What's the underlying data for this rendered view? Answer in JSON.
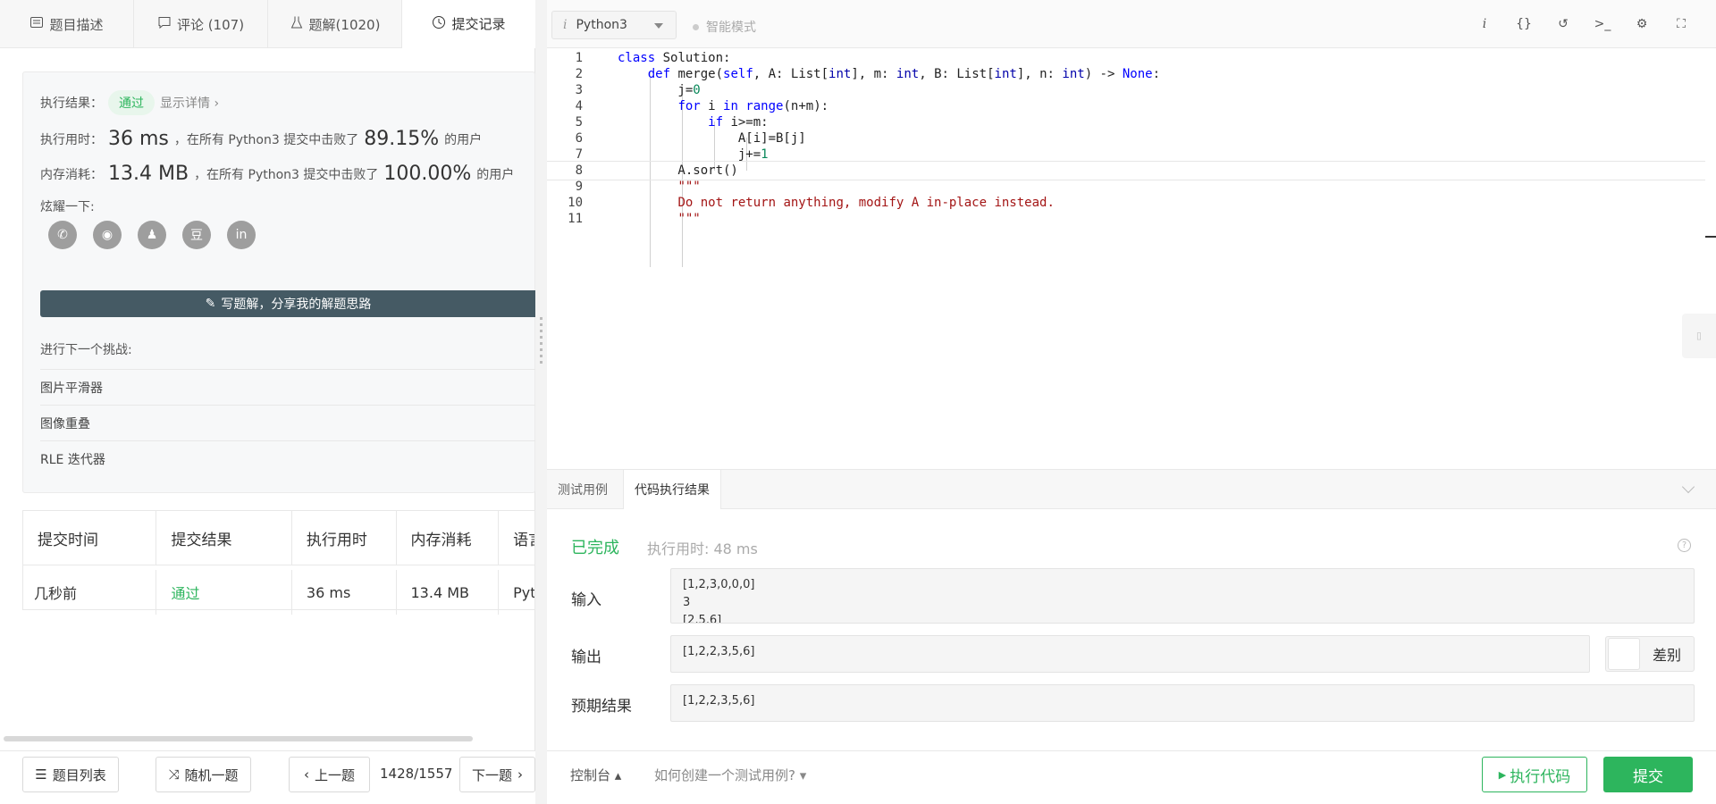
{
  "tabs": [
    {
      "label": "题目描述",
      "icon": "description-icon"
    },
    {
      "label": "评论 (107)",
      "icon": "comment-icon"
    },
    {
      "label": "题解(1020)",
      "icon": "flask-icon"
    },
    {
      "label": "提交记录",
      "icon": "clock-icon"
    }
  ],
  "result": {
    "status_label": "执行结果：",
    "status": "通过",
    "details_link": "显示详情 ›",
    "time_label": "执行用时：",
    "time_value": "36 ms",
    "time_mid": "，在所有 Python3 提交中击败了",
    "time_pct": "89.15%",
    "time_suffix": "的用户",
    "mem_label": "内存消耗：",
    "mem_value": "13.4 MB",
    "mem_mid": "，在所有 Python3 提交中击败了",
    "mem_pct": "100.00%",
    "mem_suffix": "的用户",
    "share_label": "炫耀一下:",
    "share_icons": [
      "wechat-icon",
      "weibo-icon",
      "qq-icon",
      "douban-icon",
      "linkedin-icon"
    ],
    "write_solution": "写题解，分享我的解题思路",
    "next_title": "进行下一个挑战:",
    "next_items": [
      "图片平滑器",
      "图像重叠",
      "RLE 迭代器"
    ]
  },
  "submissions": {
    "headers": [
      "提交时间",
      "提交结果",
      "执行用时",
      "内存消耗",
      "语言"
    ],
    "rows": [
      [
        "几秒前",
        "通过",
        "36 ms",
        "13.4 MB",
        "Python3"
      ]
    ]
  },
  "bottom_left": {
    "list_btn": "题目列表",
    "random_btn": "随机一题",
    "prev_btn": "上一题",
    "pager": "1428/1557",
    "next_btn": "下一题"
  },
  "editor": {
    "language": "Python3",
    "smart_mode": "智能模式",
    "lines": [
      "1",
      "2",
      "3",
      "4",
      "5",
      "6",
      "7",
      "8",
      "9",
      "10",
      "11"
    ]
  },
  "result_tabs": [
    "测试用例",
    "代码执行结果"
  ],
  "run": {
    "status": "已完成",
    "runtime": "执行用时: 48 ms",
    "input_label": "输入",
    "input_lines": [
      "[1,2,3,0,0,0]",
      "3",
      "[2,5,6]"
    ],
    "output_label": "输出",
    "output_value": "[1,2,2,3,5,6]",
    "diff_label": "差别",
    "expected_label": "预期结果",
    "expected_value": "[1,2,2,3,5,6]"
  },
  "bottom_right": {
    "console": "控制台 ▴",
    "howto": "如何创建一个测试用例? ▾",
    "run_btn": "执行代码",
    "submit_btn": "提交"
  },
  "colors": {
    "accent_green": "#2db55d",
    "dark_btn": "#455a64"
  }
}
